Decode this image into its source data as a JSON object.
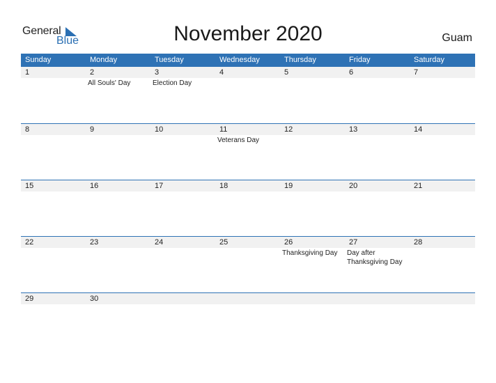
{
  "logo": {
    "line1": "General",
    "line2": "Blue"
  },
  "title": "November 2020",
  "region": "Guam",
  "weekdays": [
    "Sunday",
    "Monday",
    "Tuesday",
    "Wednesday",
    "Thursday",
    "Friday",
    "Saturday"
  ],
  "weeks": [
    {
      "days": [
        "1",
        "2",
        "3",
        "4",
        "5",
        "6",
        "7"
      ],
      "events": [
        "",
        "All Souls' Day",
        "Election Day",
        "",
        "",
        "",
        ""
      ]
    },
    {
      "days": [
        "8",
        "9",
        "10",
        "11",
        "12",
        "13",
        "14"
      ],
      "events": [
        "",
        "",
        "",
        "Veterans Day",
        "",
        "",
        ""
      ]
    },
    {
      "days": [
        "15",
        "16",
        "17",
        "18",
        "19",
        "20",
        "21"
      ],
      "events": [
        "",
        "",
        "",
        "",
        "",
        "",
        ""
      ]
    },
    {
      "days": [
        "22",
        "23",
        "24",
        "25",
        "26",
        "27",
        "28"
      ],
      "events": [
        "",
        "",
        "",
        "",
        "Thanksgiving Day",
        "Day after Thanksgiving Day",
        ""
      ]
    },
    {
      "days": [
        "29",
        "30",
        "",
        "",
        "",
        "",
        ""
      ],
      "events": [
        "",
        "",
        "",
        "",
        "",
        "",
        ""
      ]
    }
  ],
  "colors": {
    "accent": "#2e72b5",
    "daynum_bg": "#f1f1f1"
  }
}
